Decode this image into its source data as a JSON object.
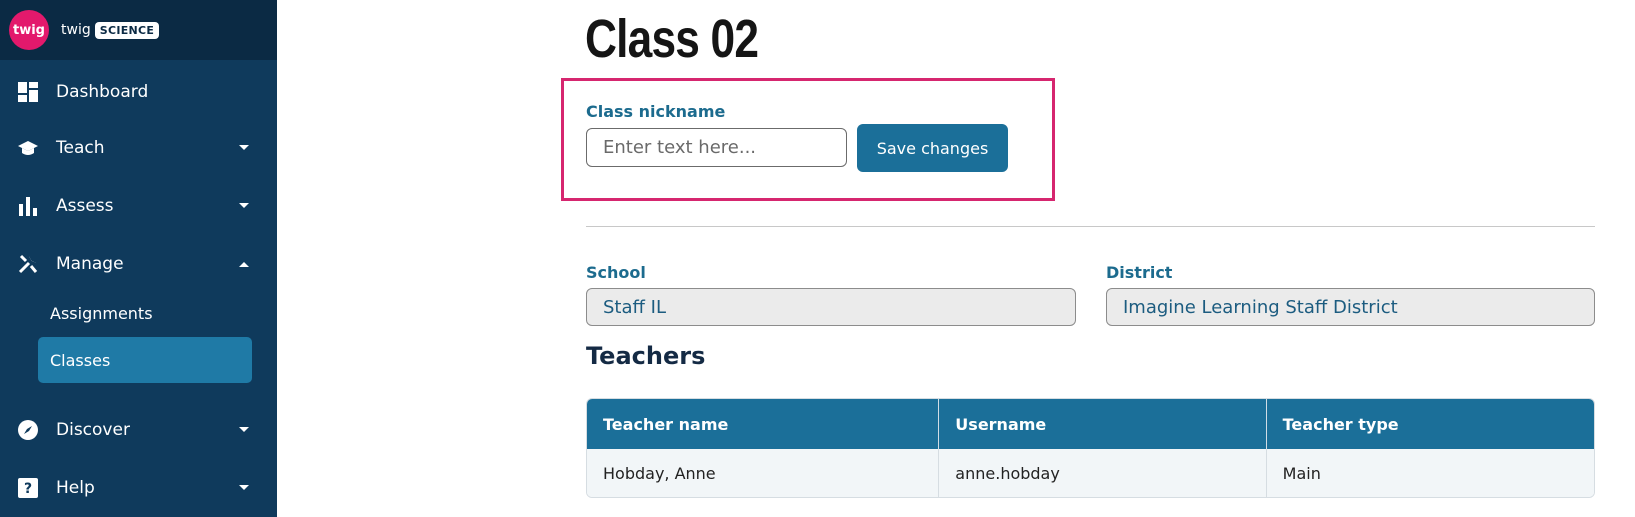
{
  "brand": {
    "logo_text": "twig",
    "name": "twig",
    "pill": "SCIENCE"
  },
  "sidebar": {
    "items": [
      {
        "label": "Dashboard",
        "icon": "dashboard-icon"
      },
      {
        "label": "Teach",
        "icon": "graduation-cap-icon",
        "caret": "down"
      },
      {
        "label": "Assess",
        "icon": "bar-chart-icon",
        "caret": "down"
      },
      {
        "label": "Manage",
        "icon": "tools-icon",
        "caret": "up"
      },
      {
        "label": "Discover",
        "icon": "compass-icon",
        "caret": "down"
      },
      {
        "label": "Help",
        "icon": "help-icon",
        "caret": "down"
      }
    ],
    "manage_sub": [
      {
        "label": "Assignments",
        "active": false
      },
      {
        "label": "Classes",
        "active": true
      }
    ]
  },
  "main": {
    "title": "Class 02",
    "nickname": {
      "label": "Class nickname",
      "placeholder": "Enter text here...",
      "value": ""
    },
    "save_label": "Save changes",
    "school": {
      "label": "School",
      "value": "Staff IL"
    },
    "district": {
      "label": "District",
      "value": "Imagine Learning Staff District"
    },
    "teachers_heading": "Teachers",
    "table": {
      "headers": [
        "Teacher name",
        "Username",
        "Teacher type"
      ],
      "rows": [
        [
          "Hobday, Anne",
          "anne.hobday",
          "Main"
        ]
      ]
    }
  },
  "colors": {
    "sidebar": "#0f3a5c",
    "accent": "#1b6f99",
    "highlight": "#d6266f",
    "logo": "#e3196c"
  }
}
